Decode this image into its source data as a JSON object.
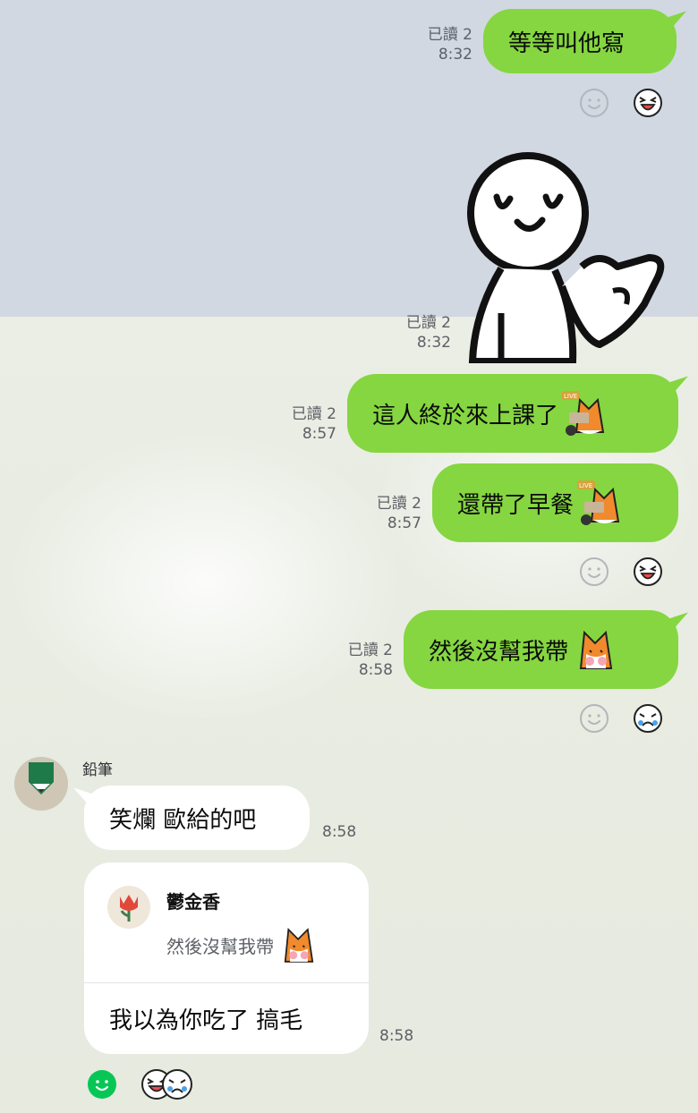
{
  "messages": [
    {
      "text": "等等叫他寫",
      "read": "已讀 2",
      "time": "8:32"
    },
    {
      "read": "已讀 2",
      "time": "8:32",
      "sticker": "stick-figure-pointing"
    },
    {
      "text": "這人終於來上課了",
      "read": "已讀 2",
      "time": "8:57",
      "emoji": "fox-live-emoji"
    },
    {
      "text": "還帶了早餐",
      "read": "已讀 2",
      "time": "8:57",
      "emoji": "fox-live-emoji"
    },
    {
      "text": "然後沒幫我帶",
      "read": "已讀 2",
      "time": "8:58",
      "emoji": "fox-crying-emoji"
    }
  ],
  "incoming": {
    "sender": "鉛筆",
    "msg1": {
      "text": "笑爛 歐給的吧",
      "time": "8:58"
    },
    "reply": {
      "quoted_name": "鬱金香",
      "quoted_text": "然後沒幫我帶",
      "text": "我以為你吃了 搞毛",
      "time": "8:58"
    }
  },
  "colors": {
    "outgoing_bubble": "#85d640",
    "incoming_bubble": "#ffffff",
    "top_band": "#d1d8e2",
    "reaction_selected": "#06c755"
  },
  "icons": {
    "reaction_add": "smile-outline-icon",
    "reaction_laugh": "laughing-face-icon",
    "reaction_cry": "crying-face-icon"
  }
}
